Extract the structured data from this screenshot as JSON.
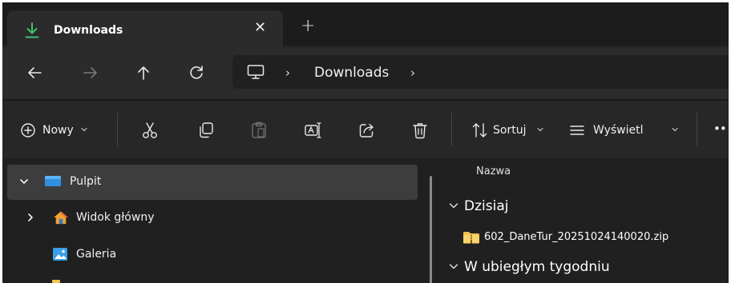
{
  "window": {
    "tab": {
      "title": "Downloads",
      "close_glyph": "✕"
    },
    "new_tab_glyph": "+"
  },
  "nav": {
    "back_icon": "arrow-left-icon",
    "forward_icon": "arrow-right-icon",
    "up_icon": "arrow-up-icon",
    "refresh_icon": "refresh-icon"
  },
  "address": {
    "root_icon": "computer-icon",
    "separator": "›",
    "crumbs": [
      "Downloads"
    ]
  },
  "commands": {
    "new_label": "Nowy",
    "sort_label": "Sortuj",
    "view_label": "Wyświetl",
    "more_glyph": "••",
    "icons": [
      "new-icon",
      "cut-icon",
      "copy-icon",
      "paste-icon",
      "rename-icon",
      "share-icon",
      "delete-icon",
      "sort-icon",
      "view-icon"
    ]
  },
  "sidebar": {
    "items": [
      {
        "label": "Pulpit",
        "selected": true
      },
      {
        "label": "Widok główny"
      },
      {
        "label": "Galeria"
      }
    ]
  },
  "content": {
    "column_name": "Nazwa",
    "groups": [
      {
        "label": "Dzisiaj",
        "files": [
          "602_DaneTur_20251024140020.zip"
        ]
      },
      {
        "label": "W ubiegłym tygodniu",
        "files": []
      }
    ]
  },
  "colors": {
    "accent_green": "#3fbf6a",
    "folder_yellow": "#f2c14e",
    "desktop_blue": "#2f8fe0",
    "window_bg": "#202020"
  }
}
